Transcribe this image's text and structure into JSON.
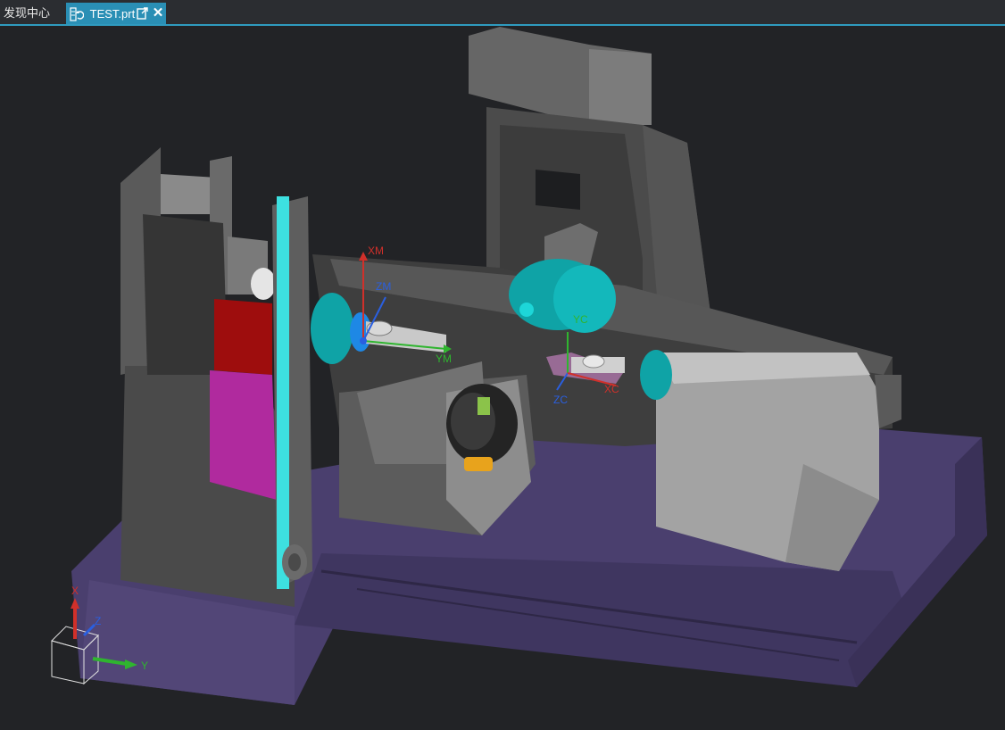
{
  "tabs": [
    {
      "label": "发现中心",
      "active": false
    },
    {
      "label": "TEST.prt",
      "active": true,
      "icons": [
        "part-modified-icon",
        "undock-icon",
        "close-icon"
      ]
    }
  ],
  "viewport": {
    "background": "#222326",
    "csys_labels": {
      "machine_x": "XM",
      "machine_z": "ZM",
      "machine_y": "YM",
      "work_y": "YC",
      "work_z": "ZC",
      "work_x": "XC"
    },
    "triad_labels": {
      "x": "X",
      "y": "Y",
      "z": "Z"
    },
    "colors": {
      "axis_x": "#d0302a",
      "axis_y": "#2fb52f",
      "axis_z": "#2a5fe0",
      "accent_teal": "#0fa3a6",
      "base_purple": "#4a3f6e",
      "guard_red": "#9e0d0d",
      "guard_magenta": "#b02a9e",
      "chain_cyan": "#3de0e0",
      "tool_orange": "#e8a31c",
      "tab_accent": "#2a8fb5"
    }
  }
}
